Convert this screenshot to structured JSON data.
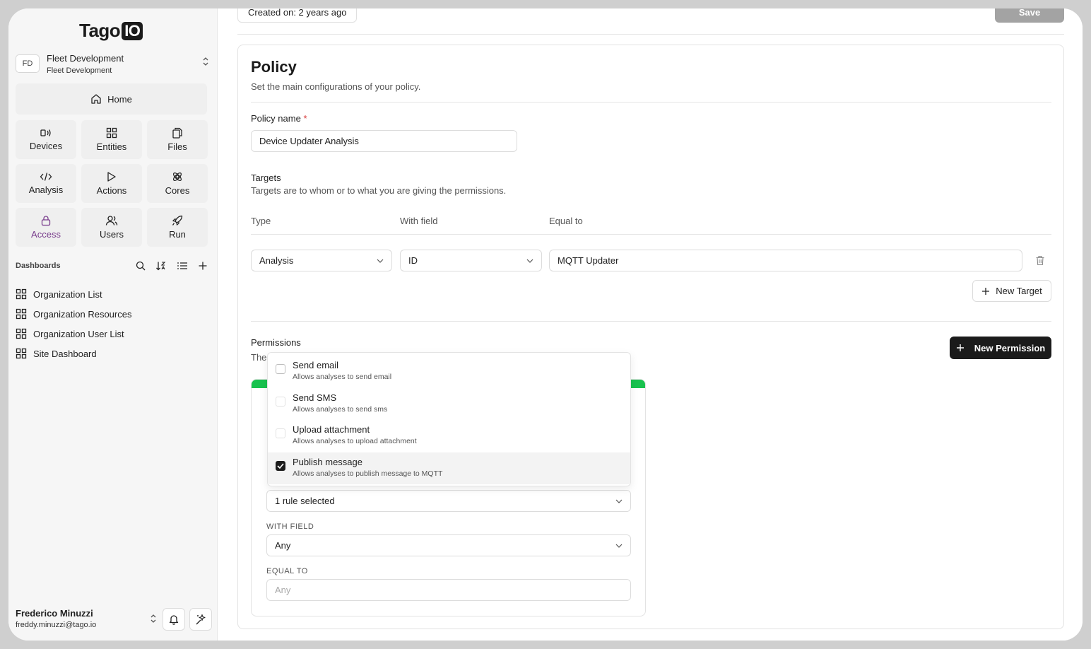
{
  "brand": {
    "logo_text": "Tago",
    "logo_box": "IO"
  },
  "org": {
    "initials": "FD",
    "name": "Fleet Development",
    "subtitle": "Fleet Development"
  },
  "nav": {
    "home_label": "Home",
    "tiles": [
      {
        "label": "Devices",
        "icon": "devices-icon",
        "active": false
      },
      {
        "label": "Entities",
        "icon": "entities-icon",
        "active": false
      },
      {
        "label": "Files",
        "icon": "files-icon",
        "active": false
      },
      {
        "label": "Analysis",
        "icon": "code-icon",
        "active": false
      },
      {
        "label": "Actions",
        "icon": "play-icon",
        "active": false
      },
      {
        "label": "Cores",
        "icon": "cores-icon",
        "active": false
      },
      {
        "label": "Access",
        "icon": "lock-icon",
        "active": true
      },
      {
        "label": "Users",
        "icon": "users-icon",
        "active": false
      },
      {
        "label": "Run",
        "icon": "rocket-icon",
        "active": false
      }
    ]
  },
  "dashboards": {
    "title": "Dashboards",
    "items": [
      "Organization List",
      "Organization Resources",
      "Organization User List",
      "Site Dashboard"
    ]
  },
  "user": {
    "name": "Frederico Minuzzi",
    "email": "freddy.minuzzi@tago.io"
  },
  "header": {
    "created": "Created on: 2 years ago",
    "save_label": "Save"
  },
  "policy": {
    "title": "Policy",
    "subtitle": "Set the main configurations of your policy.",
    "name_label": "Policy name",
    "required_mark": "*",
    "name_value": "Device Updater Analysis"
  },
  "targets": {
    "title": "Targets",
    "subtitle": "Targets are to whom or to what you are giving the permissions.",
    "col_type": "Type",
    "col_field": "With field",
    "col_equal": "Equal to",
    "type_value": "Analysis",
    "field_value": "ID",
    "equal_value": "MQTT Updater",
    "new_target_label": "New Target"
  },
  "permissions": {
    "title": "Permissions",
    "subtitle_partial": "The",
    "new_permission_label": "New Permission",
    "rules_value": "1 rule selected",
    "with_field_label": "WITH FIELD",
    "with_field_value": "Any",
    "equal_to_label": "EQUAL TO",
    "equal_to_placeholder": "Any",
    "accent_color": "#18c24e"
  },
  "rule_options": [
    {
      "title": "Send email",
      "desc": "Allows analyses to send email",
      "checked": false
    },
    {
      "title": "Send SMS",
      "desc": "Allows analyses to send sms",
      "checked": false
    },
    {
      "title": "Upload attachment",
      "desc": "Allows analyses to upload attachment",
      "checked": false
    },
    {
      "title": "Publish message",
      "desc": "Allows analyses to publish message to MQTT",
      "checked": true
    }
  ]
}
